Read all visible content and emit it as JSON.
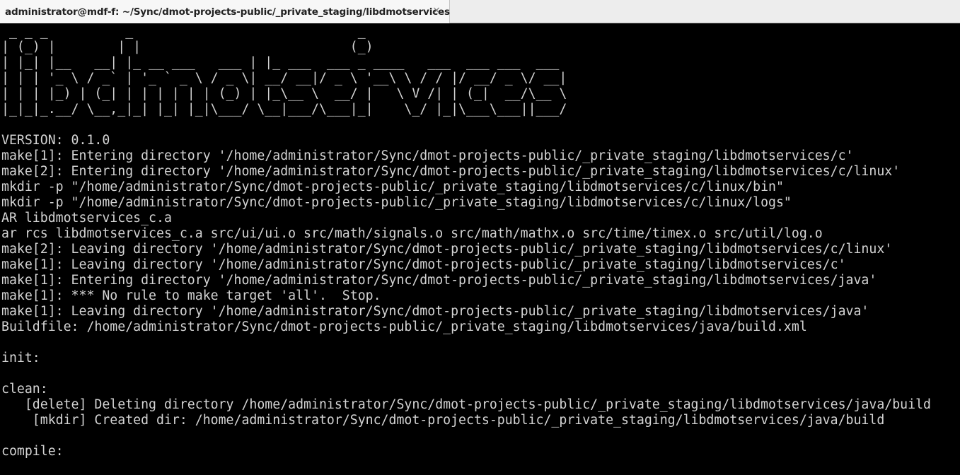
{
  "tab": {
    "title": "administrator@mdf-f: ~/Sync/dmot-projects-public/_private_staging/libdmotservices",
    "close_glyph": "×"
  },
  "colors": {
    "terminal_background": "#000000",
    "terminal_foreground": "#d3d3d3",
    "tab_background": "#f7f7f7"
  },
  "terminal": {
    "lines": [
      " _ _ _          _                             _",
      "| (_) |        | |                           (_)",
      "| |_| |__   __| |_ __ ___   ___ | |_ ___  ___ _ ____   ___  ___ ___  ___",
      "| | | '_ \\ / _` | '_ ` _ \\ / _ \\| __/ __|/ _ \\ '__\\ \\ / / |/ __/ _ \\/ __|",
      "| | | |_) | (_| | | | | | | (_) | |_\\__ \\  __/ |   \\ V /| | (_|  __/\\__ \\",
      "|_|_|_.__/ \\__,_|_| |_| |_|\\___/ \\__|___/\\___|_|    \\_/ |_|\\___\\___||___/",
      "",
      "VERSION: 0.1.0",
      "make[1]: Entering directory '/home/administrator/Sync/dmot-projects-public/_private_staging/libdmotservices/c'",
      "make[2]: Entering directory '/home/administrator/Sync/dmot-projects-public/_private_staging/libdmotservices/c/linux'",
      "mkdir -p \"/home/administrator/Sync/dmot-projects-public/_private_staging/libdmotservices/c/linux/bin\"",
      "mkdir -p \"/home/administrator/Sync/dmot-projects-public/_private_staging/libdmotservices/c/linux/logs\"",
      "AR libdmotservices_c.a",
      "ar rcs libdmotservices_c.a src/ui/ui.o src/math/signals.o src/math/mathx.o src/time/timex.o src/util/log.o",
      "make[2]: Leaving directory '/home/administrator/Sync/dmot-projects-public/_private_staging/libdmotservices/c/linux'",
      "make[1]: Leaving directory '/home/administrator/Sync/dmot-projects-public/_private_staging/libdmotservices/c'",
      "make[1]: Entering directory '/home/administrator/Sync/dmot-projects-public/_private_staging/libdmotservices/java'",
      "make[1]: *** No rule to make target 'all'.  Stop.",
      "make[1]: Leaving directory '/home/administrator/Sync/dmot-projects-public/_private_staging/libdmotservices/java'",
      "Buildfile: /home/administrator/Sync/dmot-projects-public/_private_staging/libdmotservices/java/build.xml",
      "",
      "init:",
      "",
      "clean:",
      "   [delete] Deleting directory /home/administrator/Sync/dmot-projects-public/_private_staging/libdmotservices/java/build",
      "    [mkdir] Created dir: /home/administrator/Sync/dmot-projects-public/_private_staging/libdmotservices/java/build",
      "",
      "compile:"
    ]
  }
}
